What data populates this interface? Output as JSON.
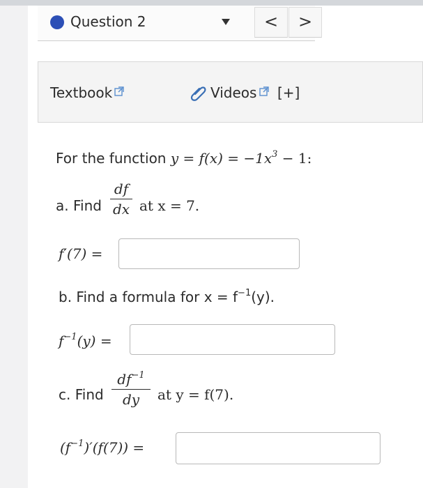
{
  "header": {
    "question_title": "Question 2",
    "prev_label": "<",
    "next_label": ">"
  },
  "resources": {
    "textbook_label": "Textbook",
    "videos_label": "Videos",
    "expand_label": "[+]"
  },
  "problem": {
    "intro_text": "For the function",
    "function_expr": "y = f(x) = −1x",
    "function_power": "3",
    "function_tail": " − 1:",
    "part_a": {
      "lead": "a. Find",
      "frac_num": "df",
      "frac_den": "dx",
      "tail": "at x = 7.",
      "answer_label": "f′(7) ="
    },
    "part_b": {
      "text": "b. Find a formula for x = f",
      "sup": "−1",
      "text_tail": "(y).",
      "answer_label_main": "f",
      "answer_label_sup": "−1",
      "answer_label_tail": "(y) ="
    },
    "part_c": {
      "lead": "c. Find",
      "frac_num_main": "df",
      "frac_num_sup": "−1",
      "frac_den": "dy",
      "tail": "at y = f(7).",
      "answer_label_pre": "(f",
      "answer_label_sup": "−1",
      "answer_label_tail": ")′(f(7)) ="
    }
  },
  "colors": {
    "accent_dot": "#2c4fb6",
    "link_icon": "#5a8fd0"
  }
}
